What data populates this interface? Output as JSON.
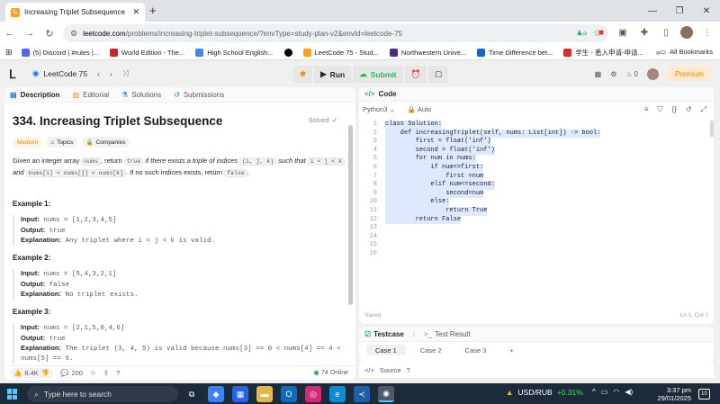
{
  "browser": {
    "tab_title": "Increasing Triplet Subsequence",
    "url_domain": "leetcode.com",
    "url_path": "/problems/increasing-triplet-subsequence/?envType=study-plan-v2&envId=leetcode-75",
    "bookmarks": [
      {
        "label": "(5) Discord | #rules |...",
        "color": "#5865f2"
      },
      {
        "label": "World Edition - The...",
        "color": "#c62828"
      },
      {
        "label": "High School English...",
        "color": "#4285f4"
      },
      {
        "label": "",
        "color": "#000000"
      },
      {
        "label": "LeetCode 75 - Stud...",
        "color": "#ffa116"
      },
      {
        "label": "Northwestern Unive...",
        "color": "#4e2a84"
      },
      {
        "label": "Time Difference bet...",
        "color": "#1565c0"
      },
      {
        "label": "学生 - 悉入申请-申请...",
        "color": "#d32f2f"
      }
    ],
    "all_bookmarks_label": "All Bookmarks"
  },
  "nav": {
    "list_title": "LeetCode 75",
    "run_label": "Run",
    "submit_label": "Submit",
    "streak": "0",
    "premium_label": "Premium"
  },
  "problem": {
    "tabs": [
      "Description",
      "Editorial",
      "Solutions",
      "Submissions"
    ],
    "title": "334. Increasing Triplet Subsequence",
    "solved_label": "Solved",
    "difficulty": "Medium",
    "topics_label": "Topics",
    "companies_label": "Companies",
    "desc_p1": "Given an integer array ",
    "desc_c1": "nums",
    "desc_p2": ", return ",
    "desc_c2": "true",
    "desc_p3": " if there exists a triple of indices ",
    "desc_c3": "(i, j, k)",
    "desc_p4": " such that ",
    "desc_c4": "i < j < k",
    "desc_p5": " and ",
    "desc_c5": "nums[i] < nums[j] < nums[k]",
    "desc_p6": ". If no such indices exists, return ",
    "desc_c6": "false",
    "desc_p7": ".",
    "examples": [
      {
        "heading": "Example 1:",
        "input": "nums = [1,2,3,4,5]",
        "output": "true",
        "explanation": "Any triplet where i < j < k is valid."
      },
      {
        "heading": "Example 2:",
        "input": "nums = [5,4,3,2,1]",
        "output": "false",
        "explanation": "No triplet exists."
      },
      {
        "heading": "Example 3:",
        "input": "nums = [2,1,5,0,4,6]",
        "output": "true",
        "explanation": "The triplet (3, 4, 5) is valid because nums[3] == 0 < nums[4] == 4 < nums[5] == 6."
      }
    ],
    "labels": {
      "input": "Input:",
      "output": "Output:",
      "explanation": "Explanation:"
    },
    "likes": "8.4K",
    "comments": "200",
    "online": "74 Online"
  },
  "code": {
    "header": "Code",
    "language": "Python3",
    "autocomplete": "Auto",
    "lines": [
      "class Solution:",
      "    def increasingTriplet(self, nums: List[int]) -> bool:",
      "        first = float('inf')",
      "        second = float('inf')",
      "        for num in nums:",
      "            if num<=first:",
      "                first =num",
      "            elif num<=second:",
      "                second=num",
      "            else:",
      "                return True",
      "        return False",
      "",
      "",
      "",
      ""
    ],
    "status": "Saved",
    "cursor": "Ln 1, Col 1"
  },
  "testpanel": {
    "testcase_label": "Testcase",
    "result_label": "Test Result",
    "cases": [
      "Case 1",
      "Case 2",
      "Case 3"
    ],
    "source_label": "Source"
  },
  "taskbar": {
    "search_placeholder": "Type here to search",
    "ticker_name": "USD/RUB",
    "ticker_change": "+0.31%",
    "time": "3:37 pm",
    "date": "29/01/2025",
    "notifications": "10"
  },
  "colors": {
    "accent": "#ffa116",
    "success": "#2db55d",
    "taskbar": "#1c2b3a"
  }
}
